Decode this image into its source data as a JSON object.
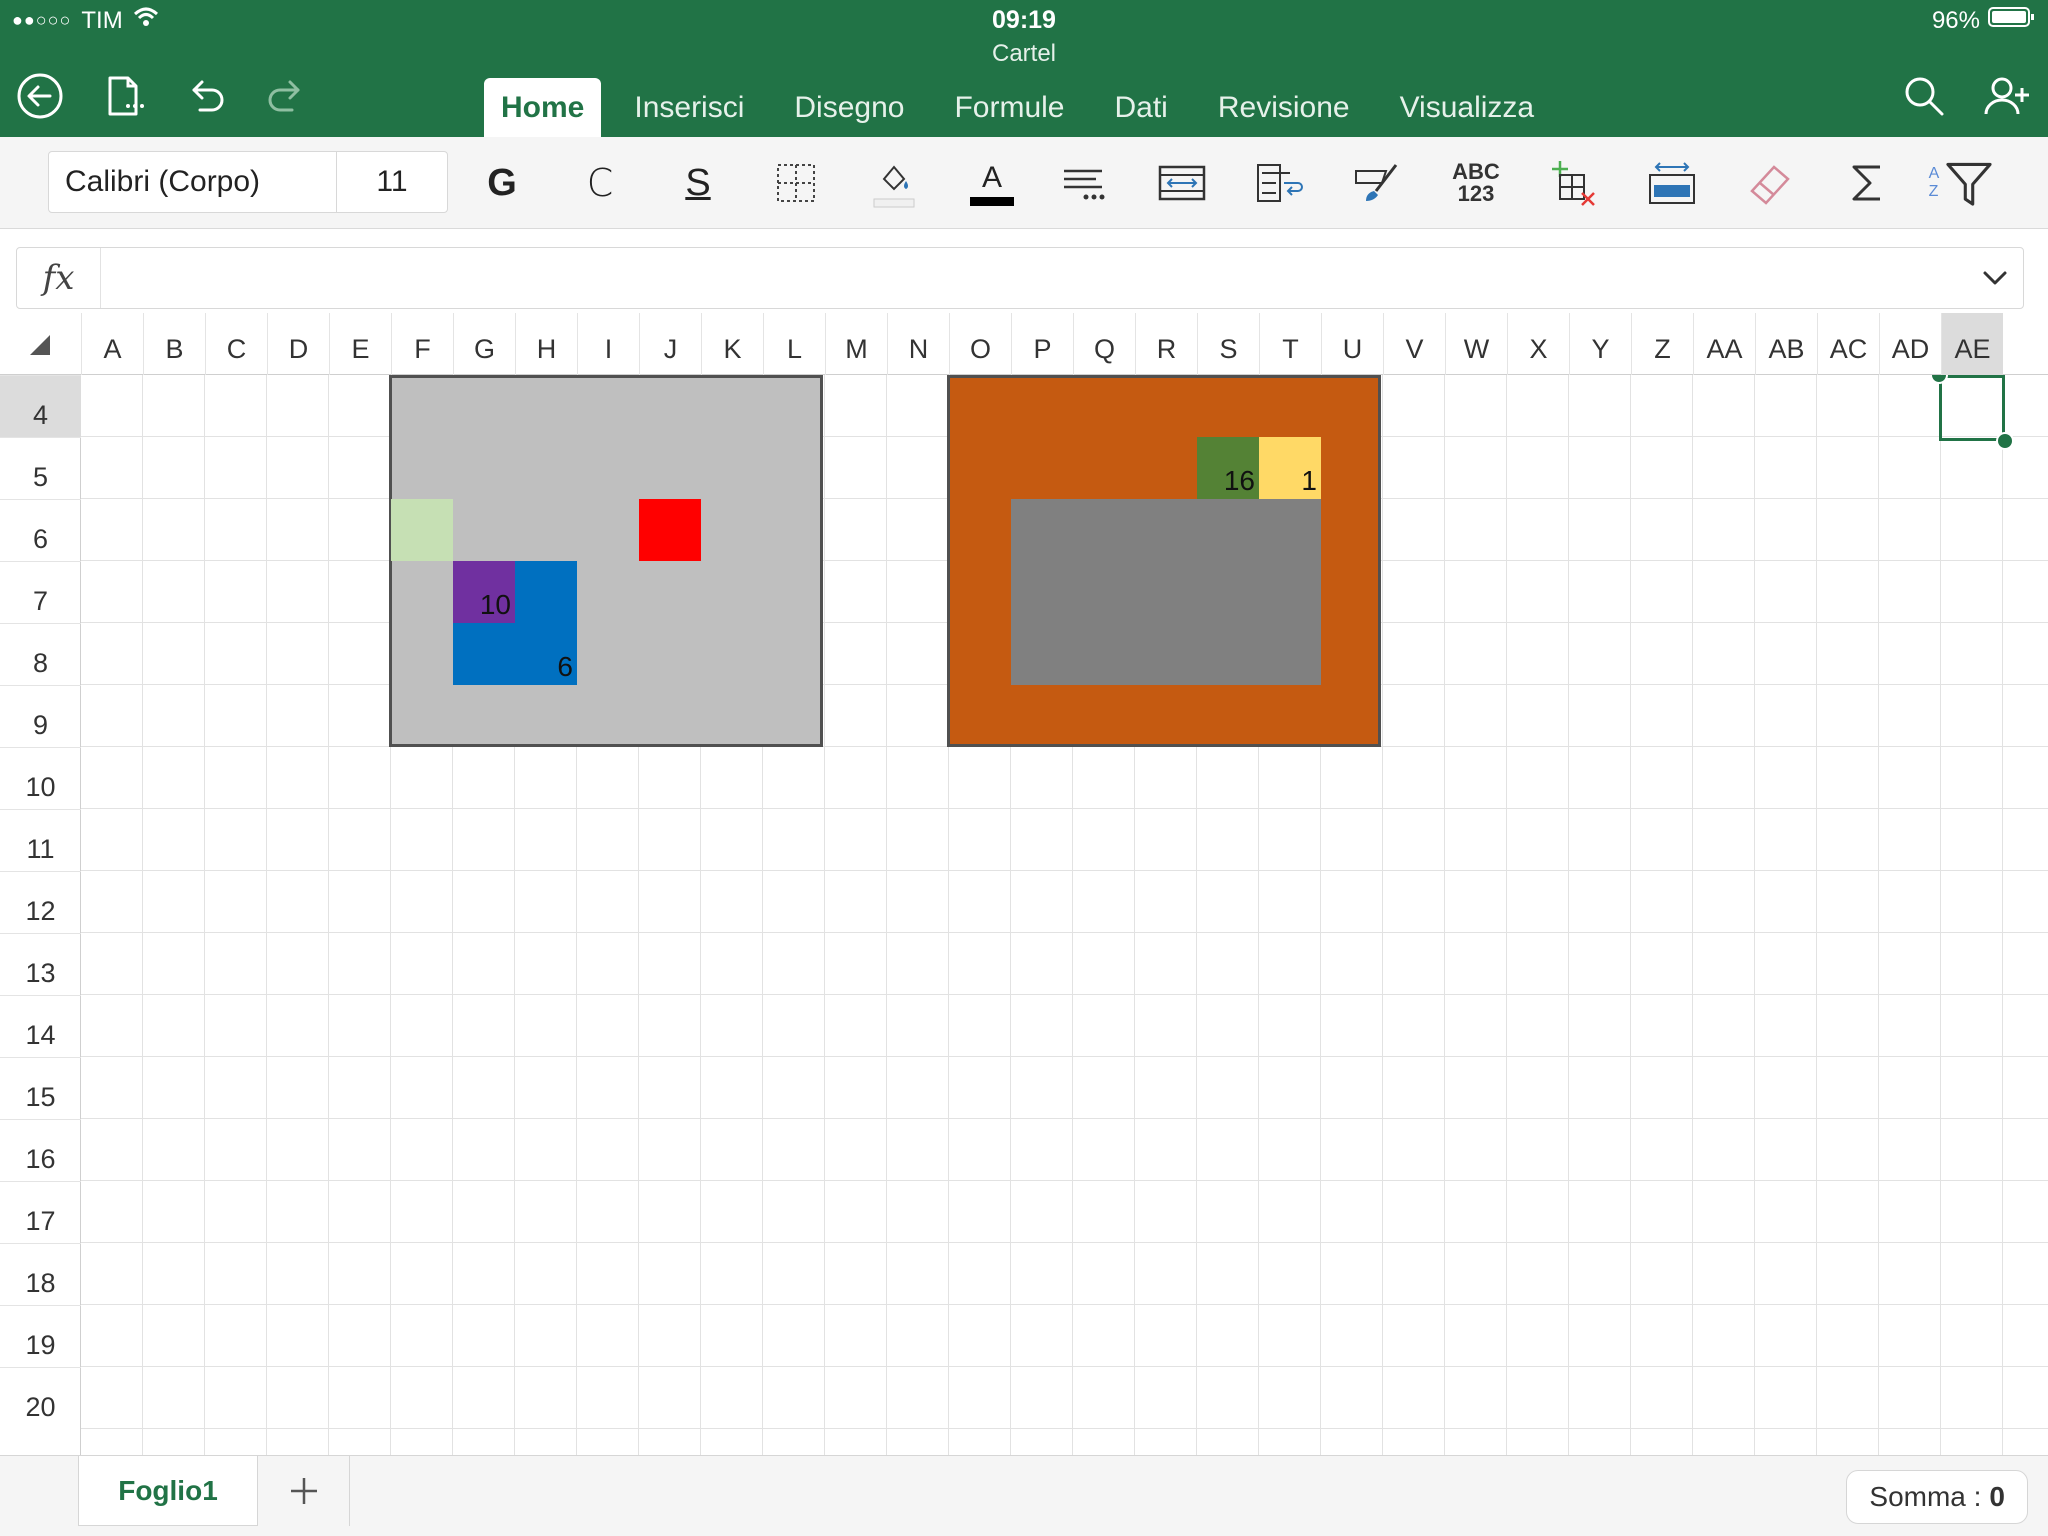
{
  "status": {
    "signal": "●●○○○",
    "carrier": "TIM",
    "time": "09:19",
    "battery": "96%"
  },
  "document": {
    "title": "Cartel"
  },
  "tabs": [
    "Home",
    "Inserisci",
    "Disegno",
    "Formule",
    "Dati",
    "Revisione",
    "Visualizza"
  ],
  "active_tab": "Home",
  "font": {
    "name": "Calibri (Corpo)",
    "size": "11"
  },
  "toolbar": {
    "bold": "G",
    "italic": "C",
    "underline": "S",
    "spell_top": "ABC",
    "spell_bottom": "123",
    "sort_a": "A",
    "sort_z": "Z"
  },
  "formula": {
    "label": "fx",
    "value": ""
  },
  "columns": [
    "A",
    "B",
    "C",
    "D",
    "E",
    "F",
    "G",
    "H",
    "I",
    "J",
    "K",
    "L",
    "M",
    "N",
    "O",
    "P",
    "Q",
    "R",
    "S",
    "T",
    "U",
    "V",
    "W",
    "X",
    "Y",
    "Z",
    "AA",
    "AB",
    "AC",
    "AD",
    "AE"
  ],
  "rows": [
    "4",
    "5",
    "6",
    "7",
    "8",
    "9",
    "10",
    "11",
    "12",
    "13",
    "14",
    "15",
    "16",
    "17",
    "18",
    "19",
    "20"
  ],
  "selected": {
    "column": "AE",
    "row": "4"
  },
  "cell_values": {
    "H7": "10",
    "I8": "6",
    "S5": "16",
    "T5": "1"
  },
  "colors": {
    "header_green": "#217346",
    "grey_block": "#bfbfbf",
    "orange_block": "#c55a11",
    "light_green": "#c6e0b4",
    "purple": "#7030a0",
    "blue": "#0070c0",
    "red": "#ff0000",
    "dark_grey": "#808080",
    "dark_green": "#548235",
    "yellow": "#ffd966"
  },
  "sheet": {
    "name": "Foglio1"
  },
  "summary": {
    "label": "Somma :",
    "value": "0"
  }
}
